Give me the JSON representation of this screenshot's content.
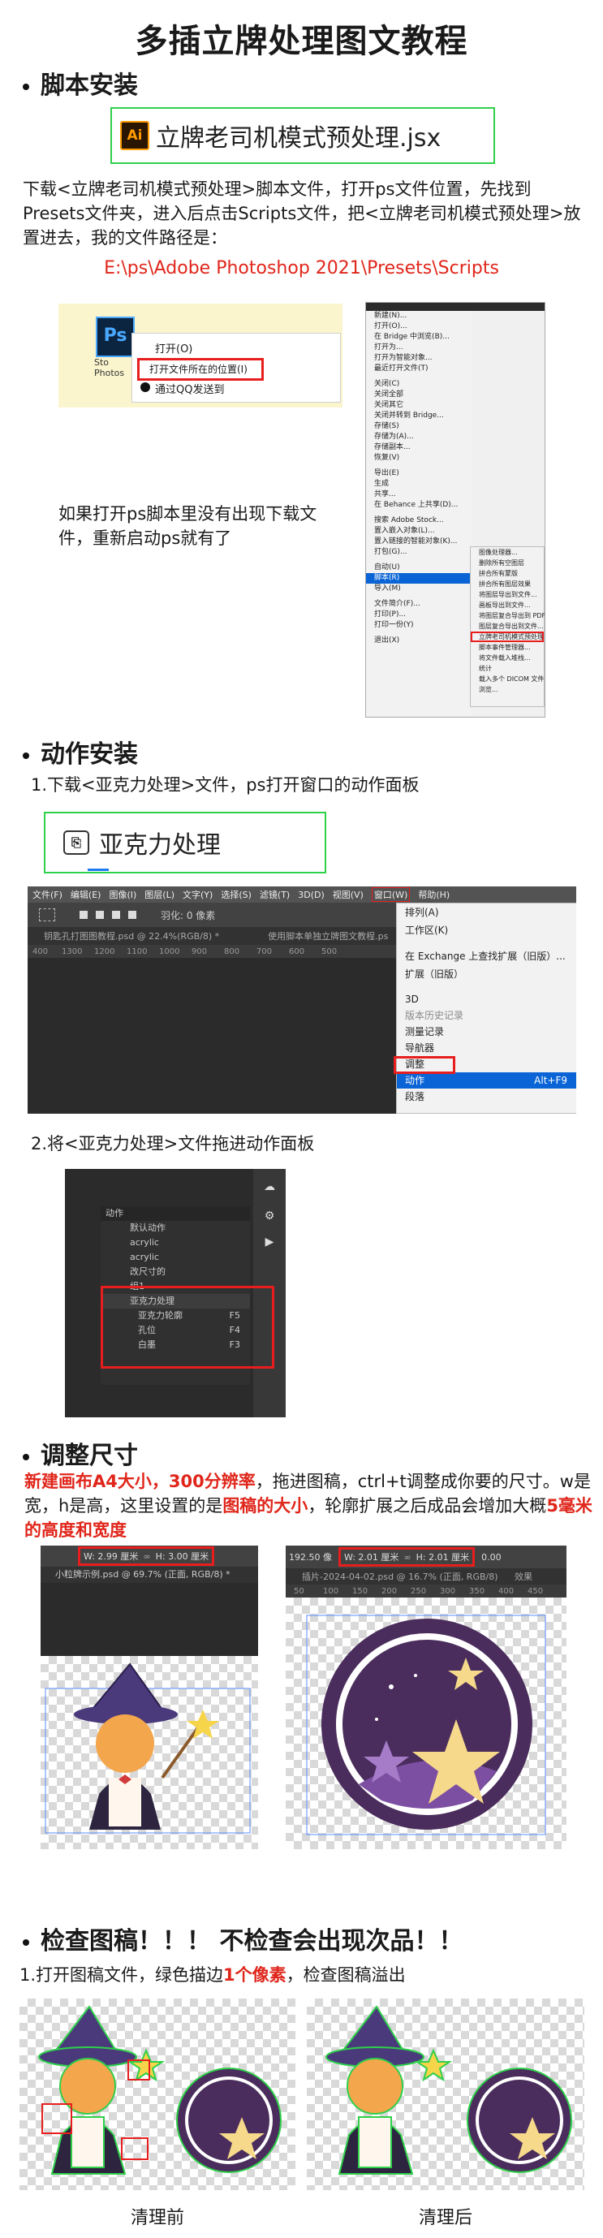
{
  "title": "多插立牌处理图文教程",
  "section1": {
    "heading": "脚本安装",
    "script_file": "立牌老司机模式预处理.jsx",
    "script_badge": "Ai",
    "para": "下载<立牌老司机模式预处理>脚本文件，打开ps文件位置，先找到Presets文件夹，进入后点击Scripts文件，把<立牌老司机模式预处理>放置进去，我的文件路径是：",
    "path": "E:\\ps\\Adobe Photoshop 2021\\Presets\\Scripts",
    "context_menu": [
      "打开(O)",
      "打开文件所在的位置(I)",
      "通过QQ发送到"
    ],
    "icon_label": "Sto Photos",
    "note": "如果打开ps脚本里没有出现下载文件，重新启动ps就有了",
    "file_menu_items": [
      "新建(N)...",
      "打开(O)...",
      "在 Bridge 中浏览(B)...",
      "打开为...",
      "打开为智能对象...",
      "最近打开文件(T)",
      "关闭(C)",
      "关闭全部",
      "关闭其它",
      "关闭并转到 Bridge...",
      "存储(S)",
      "存储为(A)...",
      "存储副本...",
      "恢复(V)",
      "导出(E)",
      "生成",
      "共享...",
      "在 Behance 上共享(D)...",
      "搜索 Adobe Stock...",
      "置入嵌入对象(L)...",
      "置入链接的智能对象(K)...",
      "打包(G)...",
      "自动(U)",
      "脚本(R)",
      "导入(M)",
      "文件简介(F)...",
      "打印(P)...",
      "打印一份(Y)",
      "退出(X)"
    ],
    "scripts_submenu": [
      "图像处理器...",
      "删除所有空图层",
      "拼合所有蒙版",
      "拼合所有图层效果",
      "将图层导出到文件...",
      "画板导出到文件...",
      "将图层复合导出到 PDF...",
      "图层复合导出到文件...",
      "立牌老司机模式预处理",
      "脚本事件管理器...",
      "将文件载入堆栈...",
      "统计",
      "载入多个 DICOM 文件...",
      "浏览..."
    ],
    "scripts_highlight": "立牌老司机模式预处理"
  },
  "section2": {
    "heading": "动作安装",
    "step1": "1.下载<亚克力处理>文件，ps打开窗口的动作面板",
    "action_file": "亚克力处理",
    "ps_menubar": [
      "文件(F)",
      "编辑(E)",
      "图像(I)",
      "图层(L)",
      "文字(Y)",
      "选择(S)",
      "滤镜(T)",
      "3D(D)",
      "视图(V)",
      "窗口(W)",
      "帮助(H)"
    ],
    "ps_options": "羽化: 0 像素",
    "ps_tab1": "钥匙孔打图图教程.psd @ 22.4%(RGB/8) *",
    "ps_tab2": "使用脚本单独立牌图文教程.ps",
    "ruler": [
      "400",
      "1300",
      "1200",
      "1100",
      "1000",
      "900",
      "800",
      "700",
      "600",
      "500"
    ],
    "window_menu": [
      "排列(A)",
      "工作区(K)",
      "在 Exchange 上查找扩展（旧版）...",
      "扩展（旧版）",
      "3D",
      "版本历史记录",
      "测量记录",
      "导航器",
      "调整",
      "动作",
      "段落"
    ],
    "window_highlight_shortcut": "Alt+F9",
    "step2": "2.将<亚克力处理>文件拖进动作面板",
    "actions_panel_title": "动作",
    "actions": [
      "默认动作",
      "acrylic",
      "acrylic",
      "改尺寸的",
      "组1",
      "亚克力处理",
      "亚克力轮廓",
      "孔位",
      "白墨"
    ],
    "action_keys": [
      "F5",
      "F4",
      "F3"
    ]
  },
  "section3": {
    "heading": "调整尺寸",
    "para_red1": "新建画布A4大小，300分辨率",
    "para_mid": "，拖进图稿，ctrl+t调整成你要的尺寸。w是宽，h是高，这里设置的是",
    "para_red2": "图稿的大小",
    "para_mid2": "，轮廓扩展之后成品会增加大概",
    "para_red3": "5毫米的高度和宽度",
    "left_w": "W: 2.99 厘米",
    "left_h": "H: 3.00 厘米",
    "left_tab": "小粒牌示例.psd @ 69.7% (正面, RGB/8) *",
    "right_pre": "192.50 像",
    "right_w": "W: 2.01 厘米",
    "right_h": "H: 2.01 厘米",
    "right_angle": "0.00",
    "right_tab": "插片-2024-04-02.psd @ 16.7% (正面, RGB/8)",
    "right_tab2": "效果",
    "ruler2": [
      "50",
      "100",
      "150",
      "200",
      "250",
      "300",
      "350",
      "400",
      "450"
    ]
  },
  "section4": {
    "heading": "检查图稿！！！ 不检查会出现次品！！",
    "para_pre": "1.打开图稿文件，绿色描边",
    "para_red": "1个像素",
    "para_post": "，检查图稿溢出",
    "caption_before": "清理前",
    "caption_after": "清理后"
  },
  "colors": {
    "accent_red": "#e0261b",
    "green_border": "#2fd04a",
    "ps_dark": "#2b2b2b",
    "highlight_blue": "#0a64d6"
  }
}
